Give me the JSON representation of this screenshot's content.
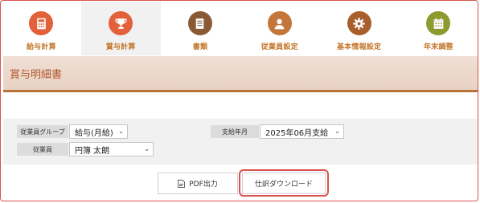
{
  "nav": {
    "items": [
      {
        "label": "給与計算",
        "icon": "calculator-icon",
        "color": "#e2603a"
      },
      {
        "label": "賞与計算",
        "icon": "trophy-icon",
        "color": "#e2603a"
      },
      {
        "label": "書類",
        "icon": "document-icon",
        "color": "#8a5a35"
      },
      {
        "label": "従業員設定",
        "icon": "person-icon",
        "color": "#c4763a"
      },
      {
        "label": "基本情報設定",
        "icon": "gear-icon",
        "color": "#a95e2e"
      },
      {
        "label": "年末調整",
        "icon": "calendar-icon",
        "color": "#8c9a2e"
      }
    ],
    "active_index": 1
  },
  "header": {
    "title": "賞与明細書"
  },
  "filters": {
    "group_label": "従業員グループ",
    "group_value": "給与(月給)",
    "employee_label": "従業員",
    "employee_value": "円簿 太朗",
    "month_label": "支給年月",
    "month_value": "2025年06月支給"
  },
  "buttons": {
    "pdf_label": "PDF出力",
    "journal_label": "仕訳ダウンロード"
  },
  "colors": {
    "accent": "#b8733b",
    "highlight": "#d9534f",
    "nav_text": "#c4762b"
  }
}
